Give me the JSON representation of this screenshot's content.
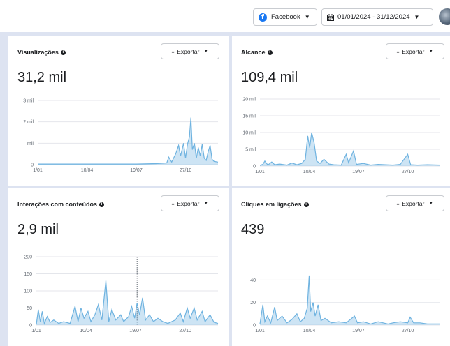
{
  "topbar": {
    "platform_label": "Facebook",
    "date_range_label": "01/01/2024 - 31/12/2024"
  },
  "colors": {
    "series": "#6fb3e0",
    "grid": "#e4e6eb",
    "divider": "#dde3f1"
  },
  "panels": [
    {
      "title": "Visualizações",
      "export_label": "Exportar",
      "value": "31,2 mil"
    },
    {
      "title": "Alcance",
      "export_label": "Exportar",
      "value": "109,4 mil"
    },
    {
      "title": "Interações com conteúdos",
      "export_label": "Exportar",
      "value": "2,9 mil"
    },
    {
      "title": "Cliques em ligações",
      "export_label": "Exportar",
      "value": "439"
    }
  ],
  "chart_data": [
    {
      "type": "area",
      "yticks": [
        {
          "v": 0,
          "label": "0"
        },
        {
          "v": 1000,
          "label": "mil"
        },
        {
          "v": 2000,
          "label": "2 mil"
        },
        {
          "v": 3000,
          "label": "3 mil"
        }
      ],
      "ylim": [
        0,
        3000
      ],
      "xticks": [
        {
          "day": 0,
          "label": "1/01"
        },
        {
          "day": 100,
          "label": "10/04"
        },
        {
          "day": 200,
          "label": "19/07"
        },
        {
          "day": 300,
          "label": "27/10"
        }
      ],
      "xlim": [
        0,
        366
      ],
      "points": [
        [
          0,
          30
        ],
        [
          50,
          30
        ],
        [
          100,
          30
        ],
        [
          150,
          30
        ],
        [
          200,
          30
        ],
        [
          240,
          50
        ],
        [
          262,
          80
        ],
        [
          266,
          350
        ],
        [
          272,
          120
        ],
        [
          280,
          500
        ],
        [
          286,
          900
        ],
        [
          290,
          400
        ],
        [
          296,
          1000
        ],
        [
          300,
          300
        ],
        [
          304,
          950
        ],
        [
          308,
          1300
        ],
        [
          311,
          2200
        ],
        [
          314,
          700
        ],
        [
          318,
          1000
        ],
        [
          322,
          300
        ],
        [
          326,
          800
        ],
        [
          330,
          400
        ],
        [
          334,
          950
        ],
        [
          338,
          300
        ],
        [
          342,
          200
        ],
        [
          346,
          600
        ],
        [
          350,
          900
        ],
        [
          354,
          250
        ],
        [
          358,
          150
        ],
        [
          366,
          120
        ]
      ]
    },
    {
      "type": "area",
      "yticks": [
        {
          "v": 0,
          "label": "0"
        },
        {
          "v": 5000,
          "label": "5 mil"
        },
        {
          "v": 10000,
          "label": "10 mil"
        },
        {
          "v": 15000,
          "label": "15 mil"
        },
        {
          "v": 20000,
          "label": "20 mil"
        }
      ],
      "ylim": [
        0,
        20000
      ],
      "xticks": [
        {
          "day": 0,
          "label": "1/01"
        },
        {
          "day": 100,
          "label": "10/04"
        },
        {
          "day": 200,
          "label": "19/07"
        },
        {
          "day": 300,
          "label": "27/10"
        }
      ],
      "xlim": [
        0,
        366
      ],
      "points": [
        [
          0,
          200
        ],
        [
          6,
          500
        ],
        [
          10,
          1500
        ],
        [
          16,
          300
        ],
        [
          24,
          1200
        ],
        [
          30,
          400
        ],
        [
          40,
          600
        ],
        [
          55,
          300
        ],
        [
          65,
          900
        ],
        [
          75,
          400
        ],
        [
          85,
          800
        ],
        [
          92,
          2000
        ],
        [
          97,
          9000
        ],
        [
          101,
          5500
        ],
        [
          105,
          10000
        ],
        [
          110,
          7000
        ],
        [
          115,
          1500
        ],
        [
          122,
          800
        ],
        [
          130,
          2000
        ],
        [
          140,
          600
        ],
        [
          150,
          400
        ],
        [
          165,
          300
        ],
        [
          175,
          3500
        ],
        [
          180,
          1000
        ],
        [
          190,
          4500
        ],
        [
          196,
          500
        ],
        [
          210,
          800
        ],
        [
          225,
          300
        ],
        [
          240,
          500
        ],
        [
          255,
          400
        ],
        [
          270,
          300
        ],
        [
          285,
          500
        ],
        [
          300,
          3500
        ],
        [
          306,
          400
        ],
        [
          320,
          300
        ],
        [
          340,
          400
        ],
        [
          366,
          300
        ]
      ]
    },
    {
      "type": "area",
      "yticks": [
        {
          "v": 0,
          "label": "0"
        },
        {
          "v": 50,
          "label": "50"
        },
        {
          "v": 100,
          "label": "100"
        },
        {
          "v": 150,
          "label": "150"
        },
        {
          "v": 200,
          "label": "200"
        }
      ],
      "ylim": [
        0,
        200
      ],
      "xticks": [
        {
          "day": 0,
          "label": "1/01"
        },
        {
          "day": 100,
          "label": "10/04"
        },
        {
          "day": 200,
          "label": "19/07"
        },
        {
          "day": 300,
          "label": "27/10"
        }
      ],
      "xlim": [
        0,
        366
      ],
      "marker_day": 203,
      "points": [
        [
          0,
          2
        ],
        [
          4,
          45
        ],
        [
          8,
          10
        ],
        [
          12,
          40
        ],
        [
          16,
          5
        ],
        [
          22,
          25
        ],
        [
          28,
          8
        ],
        [
          35,
          15
        ],
        [
          45,
          5
        ],
        [
          55,
          10
        ],
        [
          68,
          5
        ],
        [
          78,
          55
        ],
        [
          84,
          10
        ],
        [
          90,
          50
        ],
        [
          96,
          20
        ],
        [
          104,
          40
        ],
        [
          110,
          10
        ],
        [
          118,
          30
        ],
        [
          125,
          60
        ],
        [
          132,
          15
        ],
        [
          140,
          130
        ],
        [
          146,
          10
        ],
        [
          152,
          45
        ],
        [
          160,
          15
        ],
        [
          170,
          30
        ],
        [
          176,
          10
        ],
        [
          186,
          25
        ],
        [
          192,
          55
        ],
        [
          198,
          20
        ],
        [
          203,
          65
        ],
        [
          208,
          30
        ],
        [
          214,
          80
        ],
        [
          220,
          15
        ],
        [
          228,
          30
        ],
        [
          236,
          10
        ],
        [
          245,
          20
        ],
        [
          255,
          10
        ],
        [
          265,
          5
        ],
        [
          280,
          15
        ],
        [
          290,
          35
        ],
        [
          296,
          10
        ],
        [
          304,
          50
        ],
        [
          310,
          20
        ],
        [
          318,
          50
        ],
        [
          324,
          15
        ],
        [
          334,
          40
        ],
        [
          340,
          10
        ],
        [
          350,
          30
        ],
        [
          358,
          8
        ],
        [
          366,
          5
        ]
      ]
    },
    {
      "type": "area",
      "yticks": [
        {
          "v": 0,
          "label": "0"
        },
        {
          "v": 20,
          "label": "20"
        },
        {
          "v": 40,
          "label": "40"
        }
      ],
      "ylim": [
        0,
        52
      ],
      "xticks": [
        {
          "day": 0,
          "label": "1/01"
        },
        {
          "day": 100,
          "label": "10/04"
        },
        {
          "day": 200,
          "label": "19/07"
        },
        {
          "day": 300,
          "label": "27/10"
        }
      ],
      "xlim": [
        0,
        366
      ],
      "points": [
        [
          0,
          1
        ],
        [
          6,
          18
        ],
        [
          10,
          3
        ],
        [
          15,
          8
        ],
        [
          22,
          2
        ],
        [
          30,
          16
        ],
        [
          35,
          4
        ],
        [
          45,
          8
        ],
        [
          55,
          2
        ],
        [
          65,
          5
        ],
        [
          75,
          10
        ],
        [
          82,
          3
        ],
        [
          90,
          6
        ],
        [
          96,
          15
        ],
        [
          100,
          44
        ],
        [
          103,
          12
        ],
        [
          108,
          20
        ],
        [
          112,
          8
        ],
        [
          118,
          18
        ],
        [
          124,
          4
        ],
        [
          132,
          6
        ],
        [
          145,
          2
        ],
        [
          160,
          3
        ],
        [
          175,
          2
        ],
        [
          192,
          8
        ],
        [
          198,
          2
        ],
        [
          210,
          3
        ],
        [
          225,
          1
        ],
        [
          240,
          3
        ],
        [
          250,
          2
        ],
        [
          260,
          1
        ],
        [
          270,
          2
        ],
        [
          285,
          3
        ],
        [
          300,
          2
        ],
        [
          305,
          7
        ],
        [
          312,
          2
        ],
        [
          325,
          2
        ],
        [
          340,
          1
        ],
        [
          366,
          1
        ]
      ]
    }
  ]
}
